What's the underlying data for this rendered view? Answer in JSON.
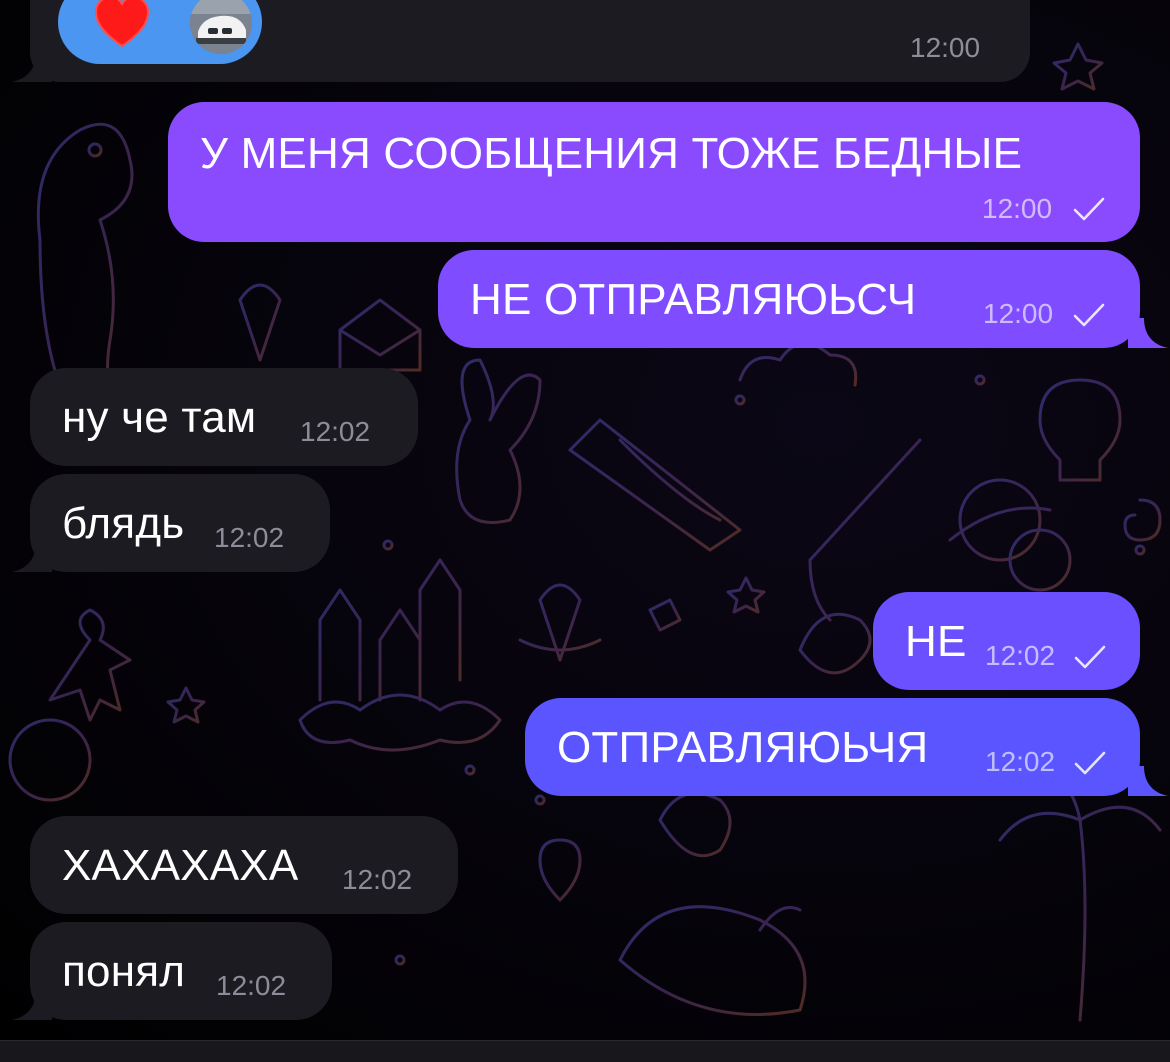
{
  "colors": {
    "incoming_bubble": "#1c1b22",
    "outgoing_bubble": "#7a4dff",
    "reaction_pill": "#4a96f0"
  },
  "top_message": {
    "time": "12:00",
    "reaction_emoji": "heart",
    "reaction_avatar": "car-avatar"
  },
  "messages": [
    {
      "id": "m1",
      "direction": "outgoing",
      "text": "У МЕНЯ СООБЩЕНИЯ ТОЖЕ БЕДНЫЕ",
      "time": "12:00",
      "status": "sent"
    },
    {
      "id": "m2",
      "direction": "outgoing",
      "text": "НЕ ОТПРАВЛЯЮЬСЧ",
      "time": "12:00",
      "status": "sent"
    },
    {
      "id": "m3",
      "direction": "incoming",
      "text": "ну че там",
      "time": "12:02"
    },
    {
      "id": "m4",
      "direction": "incoming",
      "text": "блядь",
      "time": "12:02"
    },
    {
      "id": "m5",
      "direction": "outgoing",
      "text": "НЕ",
      "time": "12:02",
      "status": "sent"
    },
    {
      "id": "m6",
      "direction": "outgoing",
      "text": "ОТПРАВЛЯЮЬЧЯ",
      "time": "12:02",
      "status": "sent"
    },
    {
      "id": "m7",
      "direction": "incoming",
      "text": "ХАХАХАХА",
      "time": "12:02"
    },
    {
      "id": "m8",
      "direction": "incoming",
      "text": "понял",
      "time": "12:02"
    }
  ]
}
